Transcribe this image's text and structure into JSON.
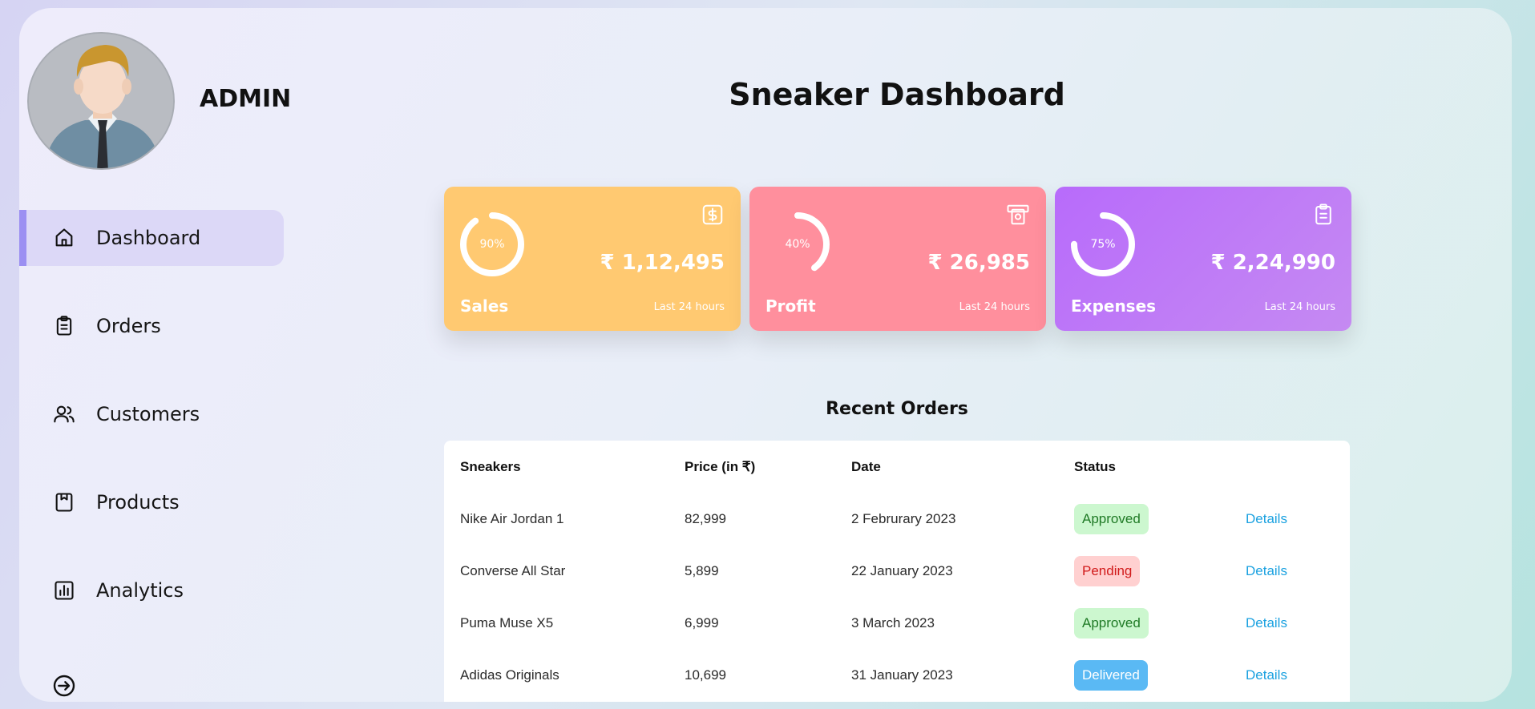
{
  "sidebar": {
    "admin_name": "ADMIN",
    "items": [
      {
        "label": "Dashboard",
        "icon": "home-icon",
        "active": true
      },
      {
        "label": "Orders",
        "icon": "clipboard-icon",
        "active": false
      },
      {
        "label": "Customers",
        "icon": "users-icon",
        "active": false
      },
      {
        "label": "Products",
        "icon": "box-icon",
        "active": false
      },
      {
        "label": "Analytics",
        "icon": "bar-chart-icon",
        "active": false
      }
    ],
    "logout_icon": "logout-icon"
  },
  "header": {
    "title": "Sneaker Dashboard"
  },
  "cards": [
    {
      "label": "Sales",
      "value": "₹ 1,12,495",
      "percent": "90%",
      "sub": "Last 24 hours",
      "icon": "dollar-icon",
      "color": "#ffc971"
    },
    {
      "label": "Profit",
      "value": "₹ 26,985",
      "percent": "40%",
      "sub": "Last 24 hours",
      "icon": "atm-icon",
      "color": "#ff8f9d"
    },
    {
      "label": "Expenses",
      "value": "₹ 2,24,990",
      "percent": "75%",
      "sub": "Last 24 hours",
      "icon": "clipboard-icon",
      "color": "#b86bfb"
    }
  ],
  "recent_orders": {
    "title": "Recent Orders",
    "columns": [
      "Sneakers",
      "Price (in ₹)",
      "Date",
      "Status"
    ],
    "rows": [
      {
        "sneaker": "Nike Air Jordan 1",
        "price": "82,999",
        "date": "2 Februrary 2023",
        "status": "Approved",
        "action": "Details"
      },
      {
        "sneaker": "Converse All Star",
        "price": "5,899",
        "date": "22 January 2023",
        "status": "Pending",
        "action": "Details"
      },
      {
        "sneaker": "Puma Muse X5",
        "price": "6,999",
        "date": "3 March 2023",
        "status": "Approved",
        "action": "Details"
      },
      {
        "sneaker": "Adidas Originals",
        "price": "10,699",
        "date": "31 January 2023",
        "status": "Delivered",
        "action": "Details"
      }
    ]
  },
  "colors": {
    "accent": "#9b8ff2",
    "approved": "#ccf7cf",
    "pending": "#ffd0d0",
    "delivered": "#5ab9f4",
    "link": "#1aa1e0"
  }
}
